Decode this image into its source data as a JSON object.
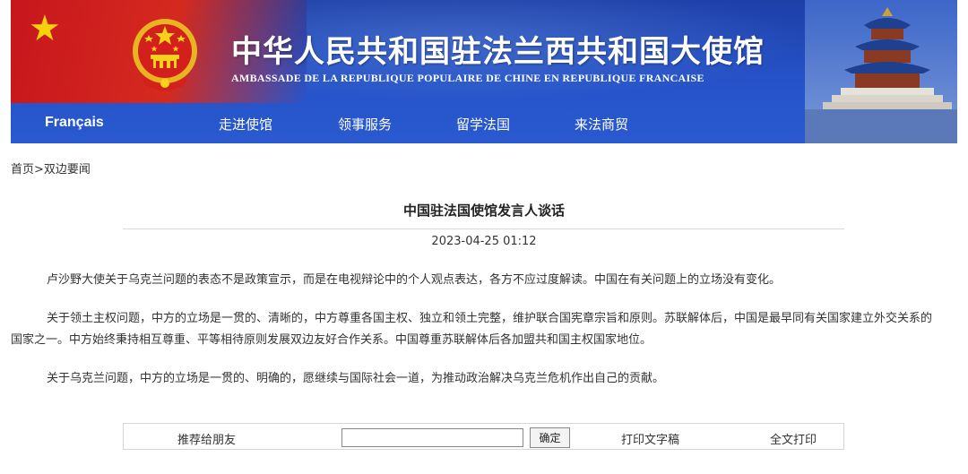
{
  "header": {
    "title_cn": "中华人民共和国驻法兰西共和国大使馆",
    "title_fr": "AMBASSADE DE LA REPUBLIQUE POPULAIRE DE CHINE EN REPUBLIQUE FRANCAISE",
    "nav": [
      {
        "label": "Français"
      },
      {
        "label": "走进使馆"
      },
      {
        "label": "领事服务"
      },
      {
        "label": "留学法国"
      },
      {
        "label": "来法商贸"
      }
    ],
    "colors": {
      "banner_blue": "#2552c7",
      "flag_red": "#c8161d",
      "star_yellow": "#f5d20a"
    }
  },
  "breadcrumb": {
    "home": "首页",
    "separator": ">",
    "current": "双边要闻"
  },
  "article": {
    "title": "中国驻法国使馆发言人谈话",
    "date": "2023-04-25 01:12",
    "paragraphs": [
      "卢沙野大使关于乌克兰问题的表态不是政策宣示，而是在电视辩论中的个人观点表达，各方不应过度解读。中国在有关问题上的立场没有变化。",
      "关于领土主权问题，中方的立场是一贯的、清晰的，中方尊重各国主权、独立和领土完整，维护联合国宪章宗旨和原则。苏联解体后，中国是最早同有关国家建立外交关系的国家之一。中方始终秉持相互尊重、平等相待原则发展双边友好合作关系。中国尊重苏联解体后各加盟共和国主权国家地位。",
      "关于乌克兰问题，中方的立场是一贯的、明确的，愿继续与国际社会一道，为推动政治解决乌克兰危机作出自己的贡献。"
    ]
  },
  "toolbar": {
    "recommend_label": "推荐给朋友",
    "input_value": "",
    "confirm_label": "确定",
    "print_text_label": "打印文字稿",
    "print_full_label": "全文打印"
  }
}
